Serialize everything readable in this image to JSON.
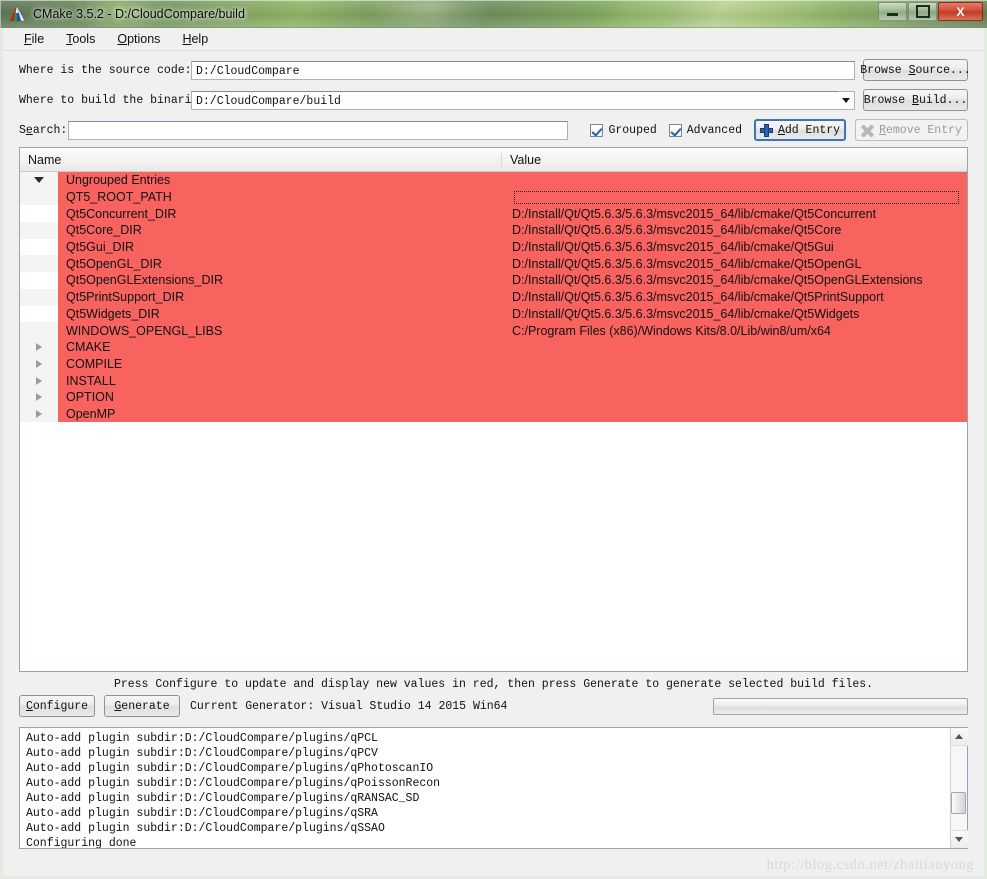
{
  "window": {
    "title": "CMake 3.5.2 - D:/CloudCompare/build",
    "app_icon": "cmake-logo-icon",
    "minimize_label": "–",
    "maximize_label": "□",
    "close_label": "X"
  },
  "menubar": [
    {
      "label": "File",
      "mnemonic": "F"
    },
    {
      "label": "Tools",
      "mnemonic": "T"
    },
    {
      "label": "Options",
      "mnemonic": "O"
    },
    {
      "label": "Help",
      "mnemonic": "H"
    }
  ],
  "paths": {
    "source_label": "Where is the source code:",
    "source_value": "D:/CloudCompare",
    "browse_source_label": "Browse Source...",
    "build_label": "Where to build the binaries:",
    "build_value": "D:/CloudCompare/build",
    "browse_build_label": "Browse Build..."
  },
  "search": {
    "label": "Search:",
    "value": "",
    "placeholder": "",
    "grouped_label": "Grouped",
    "grouped_checked": true,
    "advanced_label": "Advanced",
    "advanced_checked": true,
    "add_entry_label": "Add Entry",
    "add_entry_icon": "plus-icon",
    "remove_entry_label": "Remove Entry",
    "remove_entry_icon": "x-icon",
    "remove_entry_disabled": true
  },
  "table": {
    "columns": [
      "Name",
      "Value"
    ],
    "group_header": "Ungrouped Entries",
    "rows": [
      {
        "name": "QT5_ROOT_PATH",
        "value": "",
        "editing": true
      },
      {
        "name": "Qt5Concurrent_DIR",
        "value": "D:/Install/Qt/Qt5.6.3/5.6.3/msvc2015_64/lib/cmake/Qt5Concurrent"
      },
      {
        "name": "Qt5Core_DIR",
        "value": "D:/Install/Qt/Qt5.6.3/5.6.3/msvc2015_64/lib/cmake/Qt5Core"
      },
      {
        "name": "Qt5Gui_DIR",
        "value": "D:/Install/Qt/Qt5.6.3/5.6.3/msvc2015_64/lib/cmake/Qt5Gui"
      },
      {
        "name": "Qt5OpenGL_DIR",
        "value": "D:/Install/Qt/Qt5.6.3/5.6.3/msvc2015_64/lib/cmake/Qt5OpenGL"
      },
      {
        "name": "Qt5OpenGLExtensions_DIR",
        "value": "D:/Install/Qt/Qt5.6.3/5.6.3/msvc2015_64/lib/cmake/Qt5OpenGLExtensions"
      },
      {
        "name": "Qt5PrintSupport_DIR",
        "value": "D:/Install/Qt/Qt5.6.3/5.6.3/msvc2015_64/lib/cmake/Qt5PrintSupport"
      },
      {
        "name": "Qt5Widgets_DIR",
        "value": "D:/Install/Qt/Qt5.6.3/5.6.3/msvc2015_64/lib/cmake/Qt5Widgets"
      },
      {
        "name": "WINDOWS_OPENGL_LIBS",
        "value": "C:/Program Files (x86)/Windows Kits/8.0/Lib/win8/um/x64"
      }
    ],
    "groups": [
      "CMAKE",
      "COMPILE",
      "INSTALL",
      "OPTION",
      "OpenMP"
    ],
    "row_highlight_color": "#f8635f"
  },
  "footer": {
    "hint": "Press Configure to update and display new values in red, then press Generate to generate selected build files.",
    "configure_label": "Configure",
    "generate_label": "Generate",
    "generator_label": "Current Generator: Visual Studio 14 2015 Win64",
    "progress_percent": 0
  },
  "log": {
    "lines": [
      "Auto-add plugin subdir:D:/CloudCompare/plugins/qPCL",
      "Auto-add plugin subdir:D:/CloudCompare/plugins/qPCV",
      "Auto-add plugin subdir:D:/CloudCompare/plugins/qPhotoscanIO",
      "Auto-add plugin subdir:D:/CloudCompare/plugins/qPoissonRecon",
      "Auto-add plugin subdir:D:/CloudCompare/plugins/qRANSAC_SD",
      "Auto-add plugin subdir:D:/CloudCompare/plugins/qSRA",
      "Auto-add plugin subdir:D:/CloudCompare/plugins/qSSAO",
      "Configuring done"
    ]
  },
  "watermark": "http://blog.csdn.net/zhaitianyong"
}
